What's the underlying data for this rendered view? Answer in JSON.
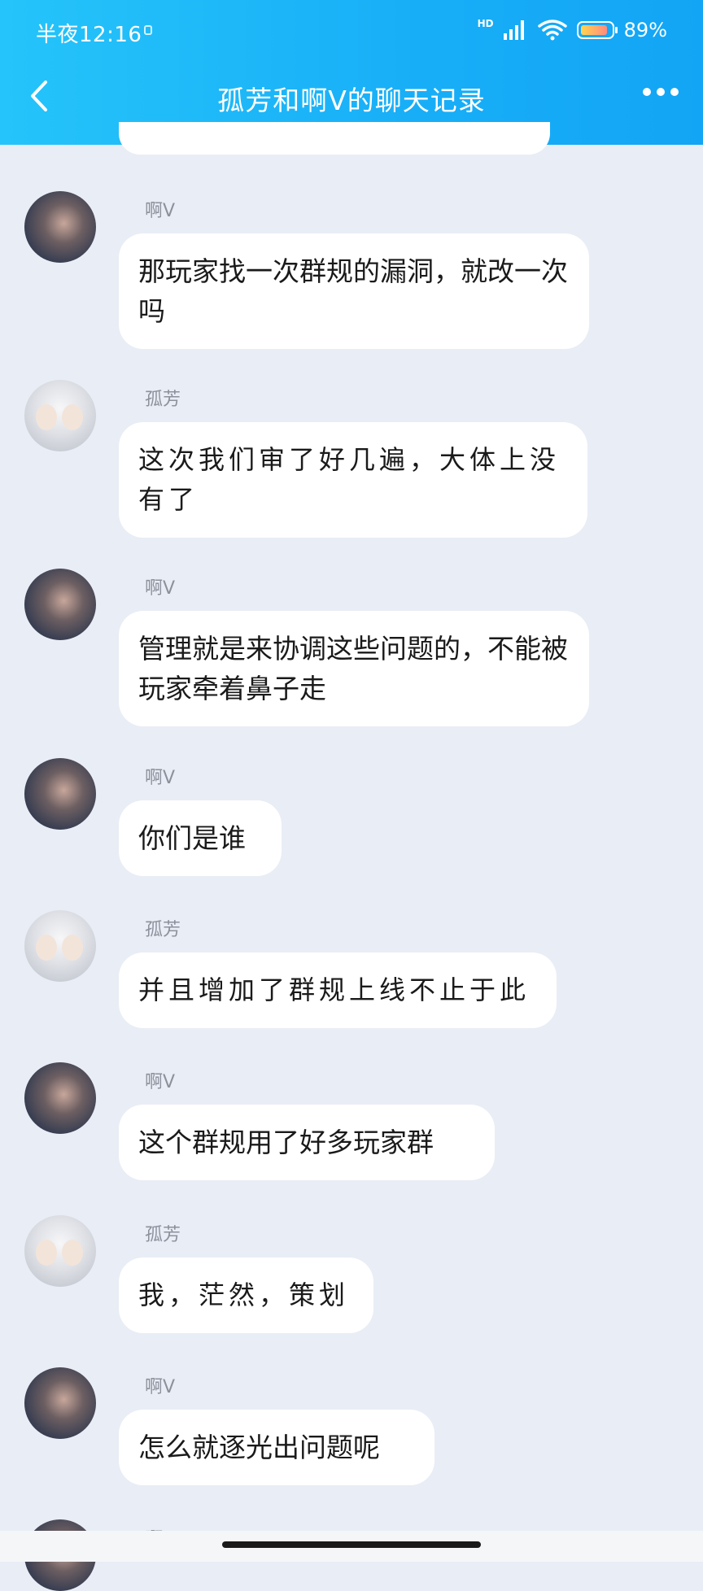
{
  "status": {
    "time": "半夜12:16",
    "network": "HD",
    "battery": "89%",
    "battery_level": 0.89
  },
  "header": {
    "title": "孤芳和啊V的聊天记录"
  },
  "messages": [
    {
      "sender": "啊V",
      "avatar": "v",
      "text": "那玩家找一次群规的漏洞，就改一次吗"
    },
    {
      "sender": "孤芳",
      "avatar": "g",
      "text": "这次我们审了好几遍，大体上没有了"
    },
    {
      "sender": "啊V",
      "avatar": "v",
      "text": "管理就是来协调这些问题的，不能被玩家牵着鼻子走"
    },
    {
      "sender": "啊V",
      "avatar": "v",
      "text": "你们是谁"
    },
    {
      "sender": "孤芳",
      "avatar": "g",
      "text": "并且增加了群规上线不止于此"
    },
    {
      "sender": "啊V",
      "avatar": "v",
      "text": "这个群规用了好多玩家群"
    },
    {
      "sender": "孤芳",
      "avatar": "g",
      "text": "我，茫然，策划"
    },
    {
      "sender": "啊V",
      "avatar": "v",
      "text": "怎么就逐光出问题呢"
    },
    {
      "sender": "啊V",
      "avatar": "v",
      "text": ""
    }
  ],
  "colors": {
    "header_start": "#25c4fa",
    "header_end": "#12a5f5",
    "background": "#e9edf5"
  }
}
